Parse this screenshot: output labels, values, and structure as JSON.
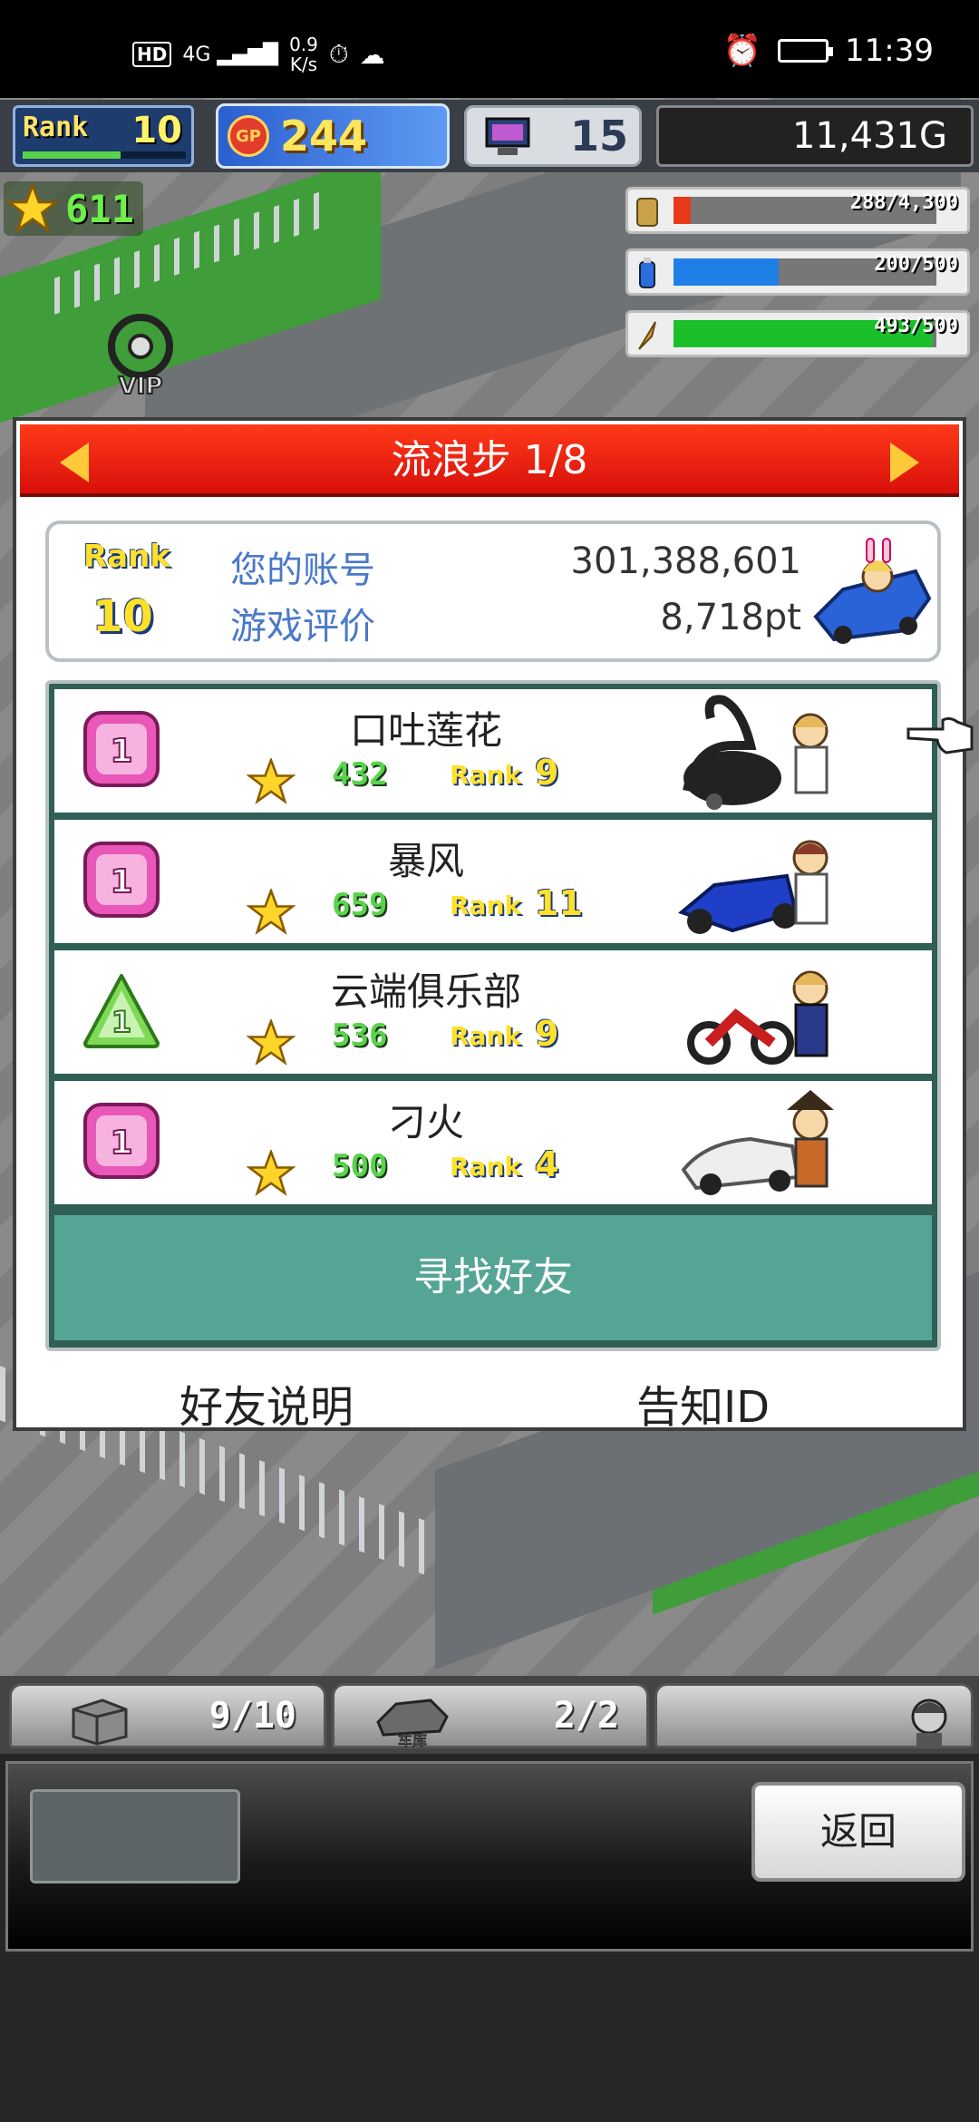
{
  "status_bar": {
    "network": "HD",
    "signal": "4G",
    "speed": "0.9",
    "speed_unit": "K/s",
    "time": "11:39"
  },
  "hud": {
    "rank_label": "Rank",
    "rank_value": "10",
    "gp_label": "GP",
    "gp_value": "244",
    "pc_value": "15",
    "money": "11,431G",
    "stars": "611"
  },
  "resources": [
    {
      "name": "money-stack",
      "text": "288/4,300",
      "fraction": 0.067,
      "color": "#e8391a"
    },
    {
      "name": "fuel-bottle",
      "text": "200/500",
      "fraction": 0.4,
      "color": "#1e7fe6"
    },
    {
      "name": "research-feather",
      "text": "493/500",
      "fraction": 0.986,
      "color": "#1bbf2a"
    }
  ],
  "dialog": {
    "title": "流浪步 1/8",
    "account": {
      "rank_label": "Rank",
      "rank_value": "10",
      "id_label": "您的账号",
      "id_value": "301,388,601",
      "rating_label": "游戏评价",
      "rating_value": "8,718pt"
    },
    "friends": [
      {
        "name": "口吐莲花",
        "badge": "1",
        "badge_shape": "square-pink",
        "stars": "432",
        "rank_label": "Rank",
        "rank": "9"
      },
      {
        "name": "暴风",
        "badge": "1",
        "badge_shape": "square-pink",
        "stars": "659",
        "rank_label": "Rank",
        "rank": "11"
      },
      {
        "name": "云端俱乐部",
        "badge": "1",
        "badge_shape": "triangle-green",
        "stars": "536",
        "rank_label": "Rank",
        "rank": "9"
      },
      {
        "name": "刁火",
        "badge": "1",
        "badge_shape": "square-pink",
        "stars": "500",
        "rank_label": "Rank",
        "rank": "4"
      }
    ],
    "find_friends": "寻找好友",
    "friend_help": "好友说明",
    "notify_id": "告知ID"
  },
  "bottom": {
    "crate_count": "9/10",
    "garage_label": "车库",
    "garage_count": "2/2",
    "team_label": "团队",
    "back": "返回"
  }
}
